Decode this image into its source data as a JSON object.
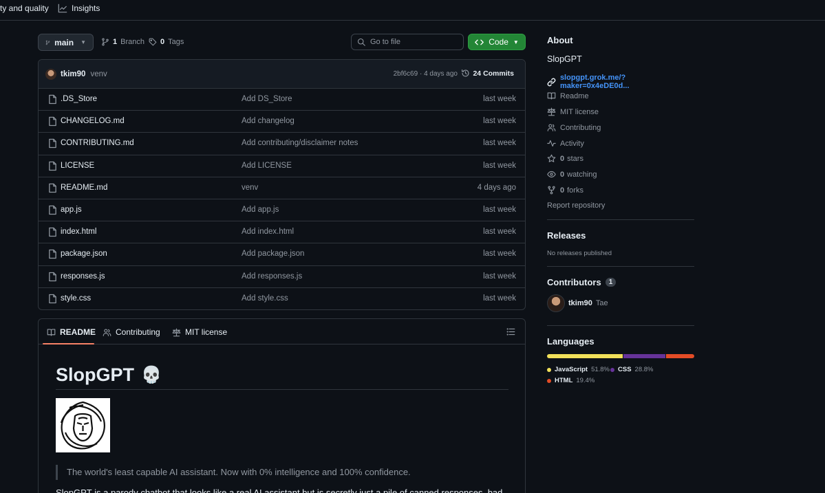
{
  "topnav": {
    "tabs": [
      {
        "label": "ty and quality",
        "icon": "none"
      },
      {
        "label": "Insights",
        "icon": "graph-icon"
      }
    ]
  },
  "repo": {
    "branch_label": "main",
    "branches_count": "1",
    "branches_label": "Branch",
    "tags_count": "0",
    "tags_label": "Tags",
    "search_placeholder": "Go to file",
    "code_label": "Code"
  },
  "commit": {
    "user": "tkim90",
    "message": "venv",
    "meta": "2bf6c69 · 4 days ago",
    "commits_label": "24 Commits"
  },
  "files": [
    {
      "name": ".DS_Store",
      "message": "Add DS_Store",
      "date": "last week"
    },
    {
      "name": "CHANGELOG.md",
      "message": "Add changelog",
      "date": "last week"
    },
    {
      "name": "CONTRIBUTING.md",
      "message": "Add contributing/disclaimer notes",
      "date": "last week"
    },
    {
      "name": "LICENSE",
      "message": "Add LICENSE",
      "date": "last week"
    },
    {
      "name": "README.md",
      "message": "venv",
      "date": "4 days ago"
    },
    {
      "name": "app.js",
      "message": "Add app.js",
      "date": "last week"
    },
    {
      "name": "index.html",
      "message": "Add index.html",
      "date": "last week"
    },
    {
      "name": "package.json",
      "message": "Add package.json",
      "date": "last week"
    },
    {
      "name": "responses.js",
      "message": "Add responses.js",
      "date": "last week"
    },
    {
      "name": "style.css",
      "message": "Add style.css",
      "date": "last week"
    }
  ],
  "readme": {
    "tabs": [
      "README",
      "Contributing",
      "MIT license"
    ],
    "title": "SlopGPT",
    "title_emoji": "💀",
    "quote": "The world's least capable AI assistant. Now with 0% intelligence and 100% confidence.",
    "description": "SlopGPT is a parody chatbot that looks like a real AI assistant but is secretly just a pile of canned responses, bad"
  },
  "about": {
    "heading": "About",
    "name": "SlopGPT",
    "link": "slopgpt.grok.me/?maker=0x4eDE0d...",
    "items": [
      {
        "label": "Readme",
        "icon": "book-icon"
      },
      {
        "label": "MIT license",
        "icon": "law-icon"
      },
      {
        "label": "Contributing",
        "icon": "people-icon"
      },
      {
        "label": "Activity",
        "icon": "pulse-icon"
      }
    ],
    "stars_count": "0",
    "stars_label": "stars",
    "watching_count": "0",
    "watching_label": "watching",
    "forks_count": "0",
    "forks_label": "forks",
    "report": "Report repository"
  },
  "releases": {
    "heading": "Releases",
    "text": "No releases published"
  },
  "contributors": {
    "heading": "Contributors",
    "count": "1",
    "user": "tkim90",
    "name": "Tae"
  },
  "languages": {
    "heading": "Languages",
    "items": [
      {
        "name": "JavaScript",
        "percent": "51.8%",
        "value": 51.8,
        "color": "#f1e05a"
      },
      {
        "name": "CSS",
        "percent": "28.8%",
        "value": 28.8,
        "color": "#663399"
      },
      {
        "name": "HTML",
        "percent": "19.4%",
        "value": 19.4,
        "color": "#e34c26"
      }
    ]
  },
  "colors": {
    "background": "#0d1117",
    "border": "#30363d",
    "accent_green": "#238636",
    "link_blue": "#4493f8"
  }
}
